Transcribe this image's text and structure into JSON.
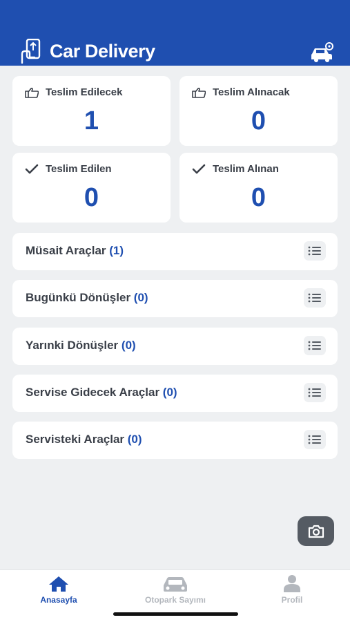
{
  "header": {
    "title": "Car Delivery",
    "color": "#1f4fb0",
    "logo_icon": "phone-hand-icon",
    "right_icon": "car-settings-icon"
  },
  "stats": [
    {
      "label": "Teslim Edilecek",
      "value": "1",
      "icon": "thumb-point-icon"
    },
    {
      "label": "Teslim Alınacak",
      "value": "0",
      "icon": "thumb-point-icon"
    },
    {
      "label": "Teslim Edilen",
      "value": "0",
      "icon": "check-icon"
    },
    {
      "label": "Teslim Alınan",
      "value": "0",
      "icon": "check-icon"
    }
  ],
  "lists": [
    {
      "label": "Müsait Araçlar",
      "count": "(1)"
    },
    {
      "label": "Bugünkü Dönüşler",
      "count": "(0)"
    },
    {
      "label": "Yarınki Dönüşler",
      "count": "(0)"
    },
    {
      "label": "Servise Gidecek Araçlar",
      "count": "(0)"
    },
    {
      "label": "Servisteki Araçlar",
      "count": "(0)"
    }
  ],
  "fab": {
    "icon": "camera-icon"
  },
  "tabs": [
    {
      "label": "Anasayfa",
      "icon": "home-icon",
      "active": true
    },
    {
      "label": "Otopark Sayımı",
      "icon": "car-icon",
      "active": false
    },
    {
      "label": "Profil",
      "icon": "user-icon",
      "active": false
    }
  ],
  "colors": {
    "accent": "#1f4fb0",
    "text": "#3a3f48",
    "inactive": "#b3b7bd",
    "background": "#eef0f2"
  }
}
